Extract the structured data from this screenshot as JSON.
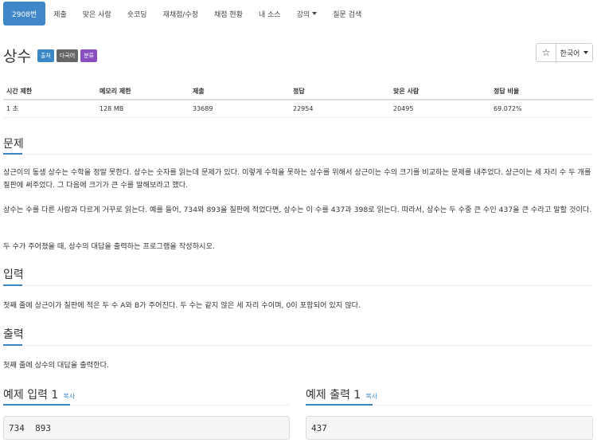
{
  "nav": {
    "items": [
      {
        "label": "2908번",
        "active": true
      },
      {
        "label": "제출"
      },
      {
        "label": "맞은 사람"
      },
      {
        "label": "숏코딩"
      },
      {
        "label": "재채점/수정"
      },
      {
        "label": "채점 현황"
      },
      {
        "label": "내 소스"
      },
      {
        "label": "강의"
      },
      {
        "label": "질문 검색"
      }
    ]
  },
  "problem": {
    "title": "상수",
    "labels": [
      "출처",
      "다국어",
      "분류"
    ],
    "language": "한국어",
    "star": "☆"
  },
  "stats": {
    "headers": [
      "시간 제한",
      "메모리 제한",
      "제출",
      "정답",
      "맞은 사람",
      "정답 비율"
    ],
    "values": [
      "1 초",
      "128 MB",
      "33689",
      "22954",
      "20495",
      "69.072%"
    ]
  },
  "sections": {
    "description": {
      "title": "문제",
      "paragraphs": [
        "상근이의 동생 상수는 수학을 정말 못한다. 상수는 숫자를 읽는데 문제가 있다. 이렇게 수학을 못하는 상수를 위해서 상근이는 수의 크기를 비교하는 문제를 내주었다. 상근이는 세 자리 수 두 개를 칠판에 써주었다. 그 다음에 크기가 큰 수를 말해보라고 했다.",
        "상수는 수를 다른 사람과 다르게 거꾸로 읽는다. 예를 들어, 734와 893을 칠판에 적었다면, 상수는 이 수를 437과 398로 읽는다. 따라서, 상수는 두 수중 큰 수인 437을 큰 수라고 말할 것이다.",
        "두 수가 주어졌을 때, 상수의 대답을 출력하는 프로그램을 작성하시오."
      ]
    },
    "input": {
      "title": "입력",
      "text": "첫째 줄에 상근이가 칠판에 적은 두 수 A와 B가 주어진다. 두 수는 같지 않은 세 자리 수이며, 0이 포함되어 있지 않다."
    },
    "output": {
      "title": "출력",
      "text": "첫째 줄에 상수의 대답을 출력한다."
    }
  },
  "samples": {
    "input_title": "예제 입력 1",
    "output_title": "예제 출력 1",
    "copy_label": "복사",
    "input_value": "734  893",
    "output_value": "437"
  }
}
